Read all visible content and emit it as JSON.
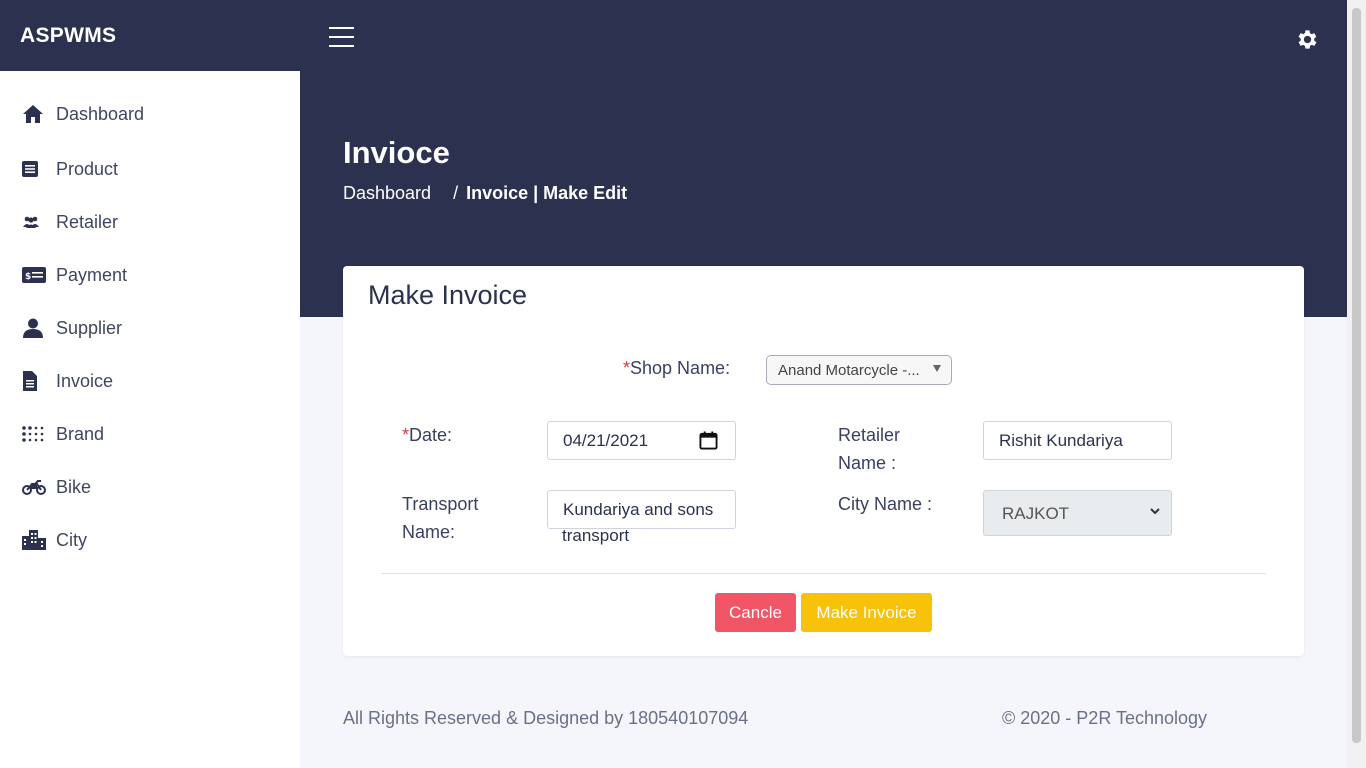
{
  "brand": "ASPWMS",
  "sidebar": {
    "items": [
      {
        "label": "Dashboard",
        "icon": "home-icon"
      },
      {
        "label": "Product",
        "icon": "list-icon"
      },
      {
        "label": "Retailer",
        "icon": "users-icon"
      },
      {
        "label": "Payment",
        "icon": "money-check-icon"
      },
      {
        "label": "Supplier",
        "icon": "user-icon"
      },
      {
        "label": "Invoice",
        "icon": "file-icon"
      },
      {
        "label": "Brand",
        "icon": "grid-dots-icon"
      },
      {
        "label": "Bike",
        "icon": "motorcycle-icon"
      },
      {
        "label": "City",
        "icon": "city-icon"
      }
    ]
  },
  "header": {
    "title": "Invioce",
    "breadcrumb": {
      "home": "Dashboard",
      "separator": "/",
      "current": "Invoice | Make Edit"
    }
  },
  "form": {
    "title": "Make Invoice",
    "required_mark": "*",
    "shop_label": "Shop Name:",
    "shop_value": "Anand Motarcycle -...",
    "date_label": "Date:",
    "date_value": "04/21/2021",
    "retailer_label_1": "Retailer",
    "retailer_label_2": "Name  :",
    "retailer_value": "Rishit Kundariya",
    "transport_label_1": "Transport",
    "transport_label_2": "Name:",
    "transport_value": "Kundariya and sons",
    "transport_overflow": "transport",
    "city_label": "City Name  :",
    "city_value": "RAJKOT",
    "cancel_label": "Cancle",
    "submit_label": "Make Invoice"
  },
  "footer": {
    "left": "All Rights Reserved & Designed by 180540107094",
    "right": "© 2020 - P2R Technology"
  },
  "colors": {
    "header_bg": "#2b314f",
    "cancel": "#f25565",
    "submit": "#f8c10a",
    "required": "#dc3545"
  }
}
